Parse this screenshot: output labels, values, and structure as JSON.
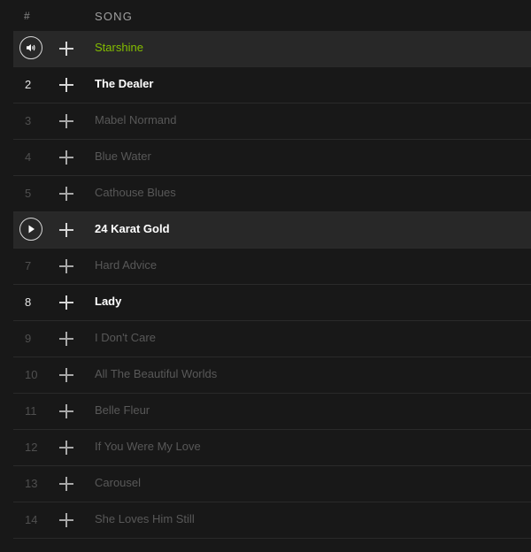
{
  "header": {
    "number_label": "#",
    "song_label": "SONG"
  },
  "colors": {
    "background": "#181818",
    "row_highlight": "#282828",
    "playing_accent": "#84bd00",
    "dim_text": "#585858",
    "bright_text": "#ffffff"
  },
  "tracks": [
    {
      "number": "",
      "title": "Starshine",
      "state": "playing",
      "lead_icon": "speaker-icon"
    },
    {
      "number": "2",
      "title": "The Dealer",
      "state": "bright",
      "lead_icon": ""
    },
    {
      "number": "3",
      "title": "Mabel Normand",
      "state": "dim",
      "lead_icon": ""
    },
    {
      "number": "4",
      "title": "Blue Water",
      "state": "dim",
      "lead_icon": ""
    },
    {
      "number": "5",
      "title": "Cathouse Blues",
      "state": "dim",
      "lead_icon": ""
    },
    {
      "number": "",
      "title": "24 Karat Gold",
      "state": "hover",
      "lead_icon": "play-icon"
    },
    {
      "number": "7",
      "title": "Hard Advice",
      "state": "dim",
      "lead_icon": ""
    },
    {
      "number": "8",
      "title": "Lady",
      "state": "bright",
      "lead_icon": ""
    },
    {
      "number": "9",
      "title": "I Don't Care",
      "state": "dim",
      "lead_icon": ""
    },
    {
      "number": "10",
      "title": "All The Beautiful Worlds",
      "state": "dim",
      "lead_icon": ""
    },
    {
      "number": "11",
      "title": "Belle Fleur",
      "state": "dim",
      "lead_icon": ""
    },
    {
      "number": "12",
      "title": "If You Were My Love",
      "state": "dim",
      "lead_icon": ""
    },
    {
      "number": "13",
      "title": "Carousel",
      "state": "dim",
      "lead_icon": ""
    },
    {
      "number": "14",
      "title": "She Loves Him Still",
      "state": "dim",
      "lead_icon": ""
    }
  ],
  "add_icon": "plus-icon"
}
